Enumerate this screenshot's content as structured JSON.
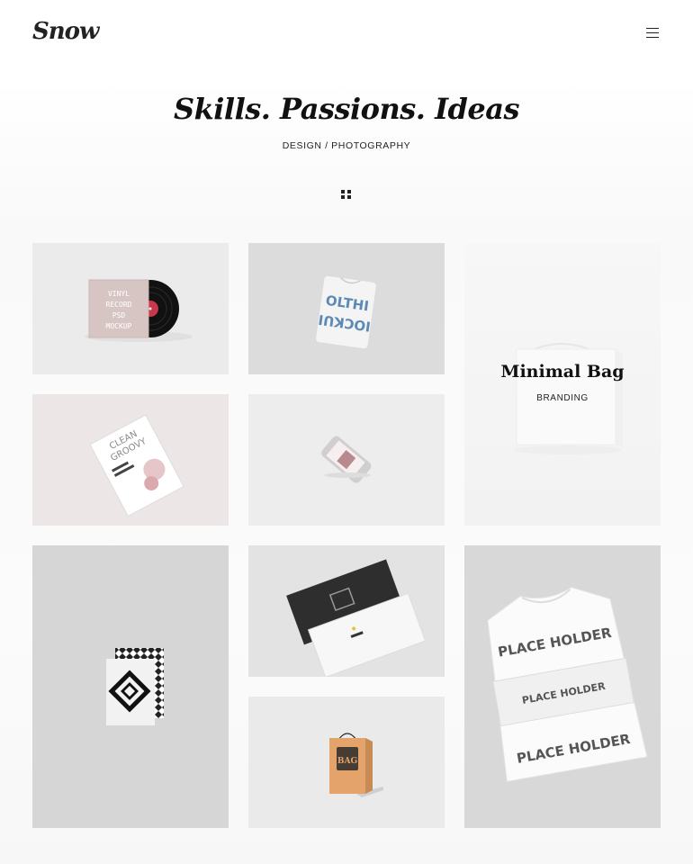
{
  "header": {
    "logo": "Snow",
    "menu_icon": "hamburger-icon"
  },
  "hero": {
    "title": "Skills. Passions. Ideas",
    "subtitle": "DESIGN / PHOTOGRAPHY",
    "filter_icon": "grid-icon"
  },
  "portfolio": {
    "items": [
      {
        "image": "vinyl-record-mockup",
        "mock_text": [
          "VINYL",
          "RECORD",
          "PSD",
          "MOCKUP"
        ]
      },
      {
        "image": "tshirt-mockup",
        "mock_text": [
          "OLTHI",
          "IOCKUI"
        ]
      },
      {
        "image": "minimal-bag-mockup",
        "title": "Minimal Bag",
        "category": "BRANDING"
      },
      {
        "image": "magazine-mockup",
        "mock_text": [
          "CLEAN",
          "GROOVY"
        ]
      },
      {
        "image": "smartphone-mockup"
      },
      {
        "image": "pattern-card-mockup"
      },
      {
        "image": "business-cards-mockup"
      },
      {
        "image": "paper-bag-mockup",
        "mock_text": [
          "BAG"
        ]
      },
      {
        "image": "folded-tshirt-mockup",
        "mock_text": [
          "PLACE HOLDER",
          "PLACE HOLDER",
          "PLACE HOLDER"
        ]
      }
    ]
  }
}
